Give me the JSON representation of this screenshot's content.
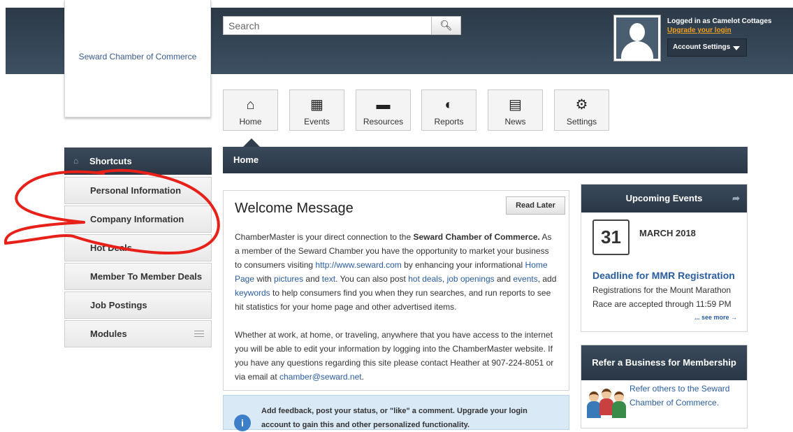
{
  "header": {
    "org_name": "Seward Chamber of Commerce",
    "search_placeholder": "Search",
    "search_icon": "magnifier-icon",
    "login_status": "Logged in as Camelot Cottages",
    "upgrade_link": "Upgrade your login",
    "account_settings": "Account Settings"
  },
  "nav": {
    "buttons": [
      {
        "label": "Home",
        "icon": "house-icon"
      },
      {
        "label": "Events",
        "icon": "calendar-icon"
      },
      {
        "label": "Resources",
        "icon": "folder-icon"
      },
      {
        "label": "Reports",
        "icon": "pie-chart-icon"
      },
      {
        "label": "News",
        "icon": "newspaper-icon"
      },
      {
        "label": "Settings",
        "icon": "gear-icon"
      }
    ]
  },
  "sidebar": {
    "header": "Shortcuts",
    "items": [
      {
        "label": "Personal Information"
      },
      {
        "label": "Company Information"
      },
      {
        "label": "Hot Deals"
      },
      {
        "label": "Member To Member Deals"
      },
      {
        "label": "Job Postings"
      },
      {
        "label": "Modules"
      }
    ]
  },
  "main": {
    "section_title": "Home",
    "welcome": {
      "title": "Welcome Message",
      "read_later": "Read Later",
      "p1_a": "ChamberMaster is your direct connection to the ",
      "p1_org": "Seward Chamber of Commerce.",
      "p1_b": " As a member of the Seward Chamber you have the opportunity to market your business to consumers visiting ",
      "p1_url": "http://www.seward.com",
      "p1_c": " by enhancing your informational ",
      "p1_homepage": "Home Page",
      "p1_d": " with ",
      "p1_pictures": "pictures",
      "p1_e": " and ",
      "p1_text": "text",
      "p1_f": ". You can also post ",
      "p1_hotdeals": "hot deals",
      "p1_g": ", ",
      "p1_jobs": "job openings",
      "p1_h": " and ",
      "p1_events": "events",
      "p1_i": ", add ",
      "p1_keywords": "keywords",
      "p1_j": " to help consumers find you when they run searches, and run reports to see hit statistics for your home page and other advertised items.",
      "p2_a": "Whether at work, at home, or traveling, anywhere that you have access to the internet you will be able to edit your information by logging into the ChamberMaster website. If you have any questions regarding this site please contact Heather at 907-224-8051 or via email at ",
      "p2_email": "chamber@seward.net",
      "p2_b": "."
    },
    "feedback": "Add feedback, post your status, or \"like\" a comment. Upgrade your login account to gain this and other personalized functionality."
  },
  "events_panel": {
    "title": "Upcoming Events",
    "day": "31",
    "month": "MARCH 2018",
    "event_title": "Deadline for MMR Registration",
    "event_desc": "Registrations for the Mount Marathon Race are accepted through 11:59 PM",
    "see_more": "... see more →"
  },
  "refer_panel": {
    "title": "Refer a Business for Membership",
    "text": "Refer others to the Seward Chamber of Commerce."
  },
  "colors": {
    "header_dark": "#2c3947",
    "link": "#2a5d9f",
    "upgrade": "#f0a020",
    "annotation_red": "#e8201a"
  }
}
